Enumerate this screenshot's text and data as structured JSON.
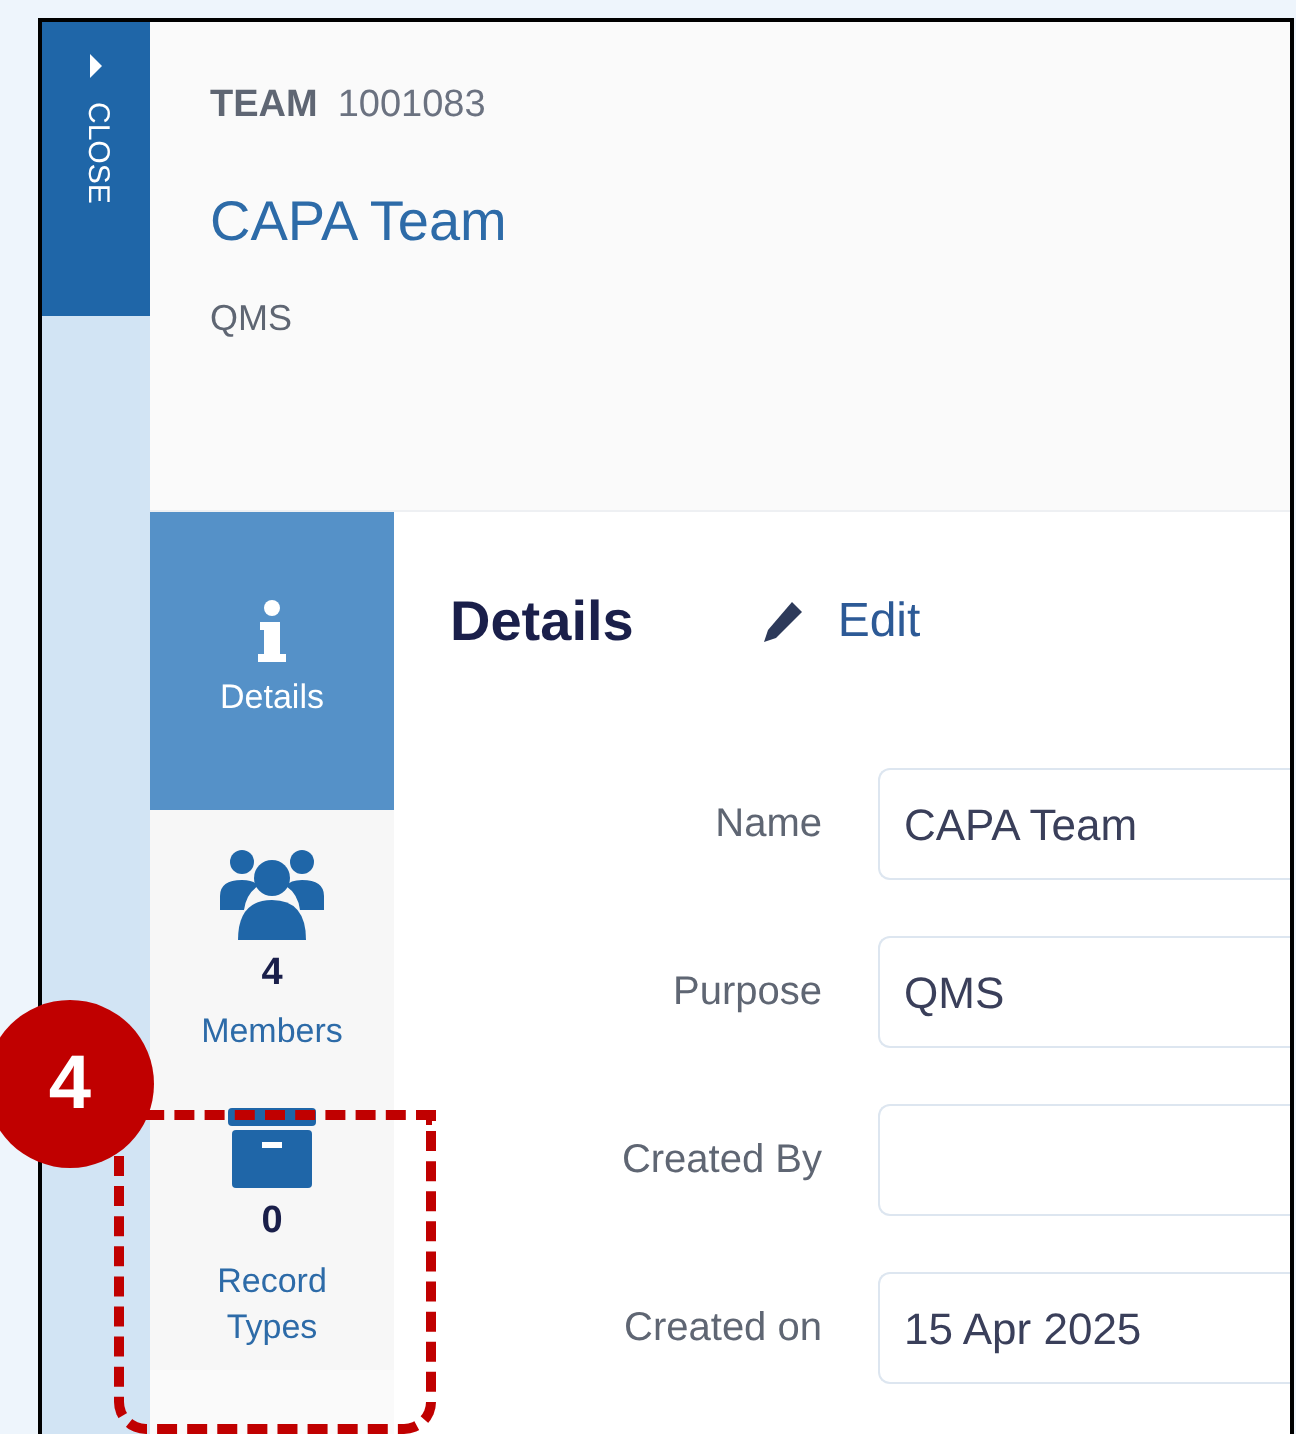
{
  "side_tab": {
    "label": "CLOSE"
  },
  "header": {
    "type_label": "TEAM",
    "number": "1001083",
    "title": "CAPA Team",
    "subtitle": "QMS"
  },
  "nav": [
    {
      "kind": "info",
      "label": "Details",
      "selected": true
    },
    {
      "kind": "members",
      "count": "4",
      "label": "Members",
      "selected": false
    },
    {
      "kind": "records",
      "count": "0",
      "label": "Record Types",
      "selected": false
    }
  ],
  "details": {
    "title": "Details",
    "edit": "Edit",
    "fields": [
      {
        "label": "Name",
        "value": "CAPA Team"
      },
      {
        "label": "Purpose",
        "value": "QMS"
      },
      {
        "label": "Created By"
      },
      {
        "label": "Created on",
        "value": "15 Apr 2025"
      }
    ]
  },
  "callout": {
    "number": "4"
  }
}
